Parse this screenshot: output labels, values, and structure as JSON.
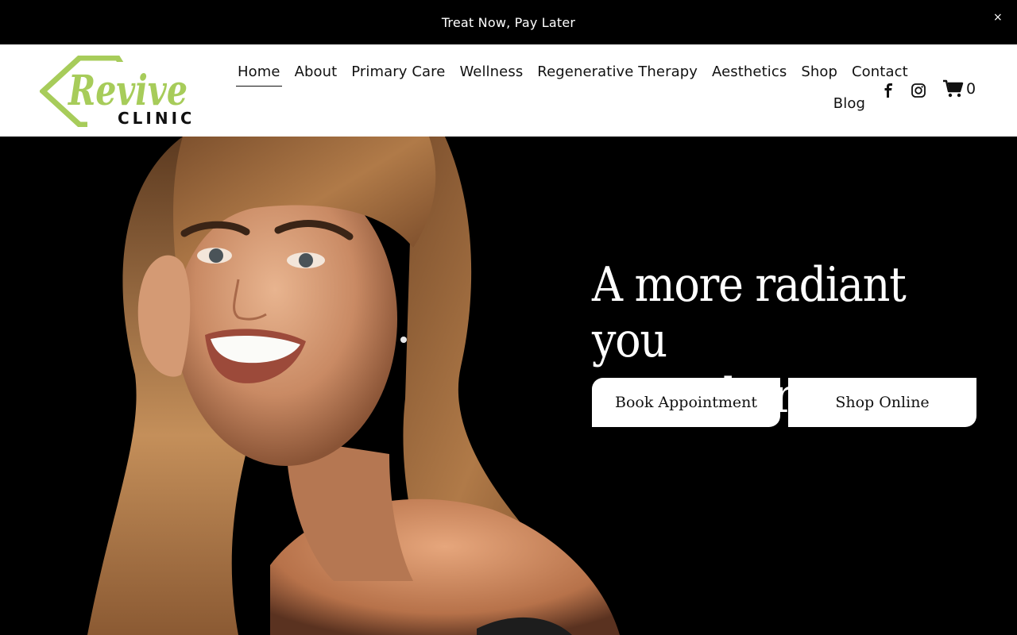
{
  "announcement": {
    "text": "Treat Now, Pay Later",
    "close_symbol": "×"
  },
  "brand": {
    "name_line1": "Revive",
    "name_line2": "CLINIC",
    "color": "#a7cc5a"
  },
  "nav": {
    "items": [
      {
        "label": "Home",
        "active": true
      },
      {
        "label": "About"
      },
      {
        "label": "Primary Care"
      },
      {
        "label": "Wellness"
      },
      {
        "label": "Regenerative Therapy"
      },
      {
        "label": "Aesthetics"
      },
      {
        "label": "Shop"
      },
      {
        "label": "Contact"
      }
    ],
    "second_row": {
      "label": "Blog"
    }
  },
  "social": {
    "facebook_icon": "facebook-icon",
    "instagram_icon": "instagram-icon"
  },
  "cart": {
    "icon": "cart-icon",
    "count": "0"
  },
  "hero": {
    "headline_line1": "A more radiant you",
    "headline_line2": "starts here.",
    "buttons": {
      "primary": "Book Appointment",
      "secondary": "Shop Online"
    },
    "photo": "smiling woman portrait"
  },
  "colors": {
    "announcement_bg": "#000000",
    "header_bg": "#ffffff",
    "hero_bg": "#000000",
    "button_bg": "#ffffff"
  }
}
